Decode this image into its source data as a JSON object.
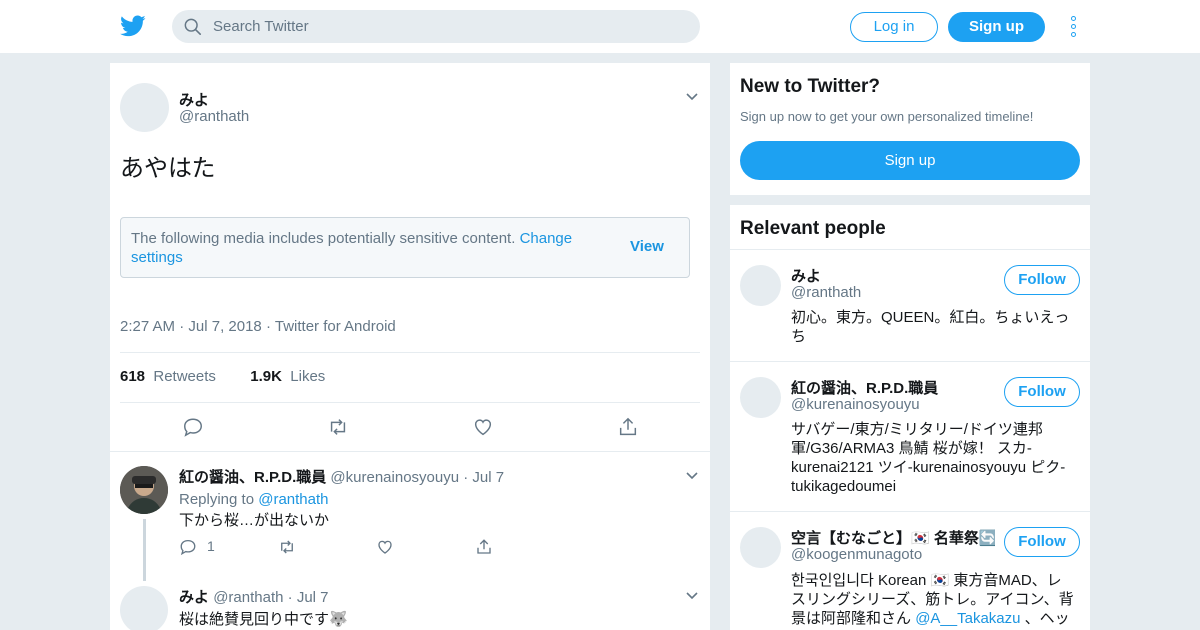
{
  "header": {
    "search_placeholder": "Search Twitter",
    "login_label": "Log in",
    "signup_label": "Sign up"
  },
  "tweet": {
    "name": "みよ",
    "handle": "@ranthath",
    "text": "あやはた",
    "sensitive_text": "The following media includes potentially sensitive content.",
    "sensitive_link": "Change settings",
    "sensitive_view": "View",
    "time": "2:27 AM",
    "date": "Jul 7, 2018",
    "source": "Twitter for Android",
    "retweets_count": "618",
    "retweets_label": "Retweets",
    "likes_count": "1.9K",
    "likes_label": "Likes"
  },
  "replies": [
    {
      "name": "紅の醤油、R.P.D.職員",
      "handle": "@kurenainosyouyu",
      "date": "Jul 7",
      "replying_prefix": "Replying to",
      "replying_to": "@ranthath",
      "text": "下から桜…が出ないか",
      "reply_count": "1"
    },
    {
      "name": "みよ",
      "handle": "@ranthath",
      "date": "Jul 7",
      "text": "桜は絶賛見回り中です🐺"
    }
  ],
  "sidebar": {
    "new_title": "New to Twitter?",
    "new_subtitle": "Sign up now to get your own personalized timeline!",
    "signup_label": "Sign up",
    "relevant_title": "Relevant people",
    "follow_label": "Follow",
    "people": [
      {
        "name": "みよ",
        "handle": "@ranthath",
        "bio": "初心。東方。QUEEN。紅白。ちょいえっち"
      },
      {
        "name": "紅の醤油、R.P.D.職員",
        "handle": "@kurenainosyouyu",
        "bio": "サバゲー/東方/ミリタリー/ドイツ連邦軍/G36/ARMA3 鳥鯖 桜が嫁！ スカ-kurenai2121 ツイ-kurenainosyouyu ピク-tukikagedoumei"
      },
      {
        "name": "空言【むなごと】🇰🇷 名華祭🔄",
        "handle": "@koogenmunagoto",
        "bio_a": "한국인입니다 Korean 🇰🇷 東方音MAD、レスリングシリーズ、筋トレ。アイコン、背景は阿部隆和さん",
        "bio_link": "@A__Takakazu",
        "bio_b": "、ヘッ"
      }
    ]
  }
}
